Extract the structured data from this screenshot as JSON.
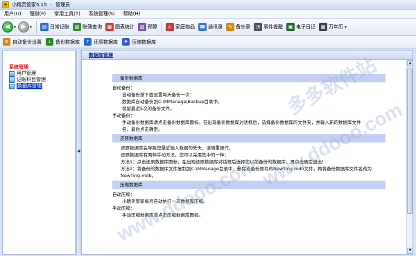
{
  "window": {
    "title": "小精灵管家5.15",
    "separator": "-",
    "user": "管理员"
  },
  "menu": [
    "用户(U)",
    "理财(F)",
    "常用工具(T)",
    "系统管理(S)",
    "帮助(H)"
  ],
  "toolbar": {
    "buttons": [
      {
        "label": "日常记账",
        "icon": "ledger-icon",
        "color": "#2f6fd0"
      },
      {
        "label": "账簿查询",
        "icon": "book-icon",
        "color": "#3a8a3a"
      },
      {
        "label": "图表统计",
        "icon": "chart-icon",
        "color": "#d04040"
      },
      {
        "label": "预算",
        "icon": "budget-icon",
        "color": "#7a5aa8"
      },
      {
        "label": "家庭物品",
        "icon": "home-items-icon",
        "color": "#c43a3a"
      },
      {
        "label": "通讯录",
        "icon": "contacts-icon",
        "color": "#3a7ac4"
      },
      {
        "label": "备忘录",
        "icon": "memo-icon",
        "color": "#d48a1a"
      },
      {
        "label": "事件提醒",
        "icon": "alarm-clock-icon",
        "color": "#555555"
      },
      {
        "label": "电子日记",
        "icon": "diary-icon",
        "color": "#2a6a2a"
      },
      {
        "label": "万年历",
        "icon": "calendar-icon",
        "color": "#444444"
      }
    ]
  },
  "toolbar2": {
    "buttons": [
      {
        "label": "自动备份设置",
        "icon": "backup-settings-icon",
        "color": "#c98a1a"
      },
      {
        "label": "备份数据库",
        "icon": "backup-db-icon",
        "color": "#2a8a2a"
      },
      {
        "label": "还原数据库",
        "icon": "restore-db-icon",
        "color": "#2a6ac4"
      },
      {
        "label": "压缩数据库",
        "icon": "compress-db-icon",
        "color": "#3a5ad4"
      }
    ]
  },
  "sidebar": {
    "root": "系统管理",
    "items": [
      {
        "label": "用户管理",
        "selected": false
      },
      {
        "label": "记账科目管理",
        "selected": false
      },
      {
        "label": "数据库管理",
        "selected": true
      }
    ]
  },
  "main": {
    "header": "数据库管理",
    "sections": [
      {
        "heading": "备份数据库",
        "lines": [
          {
            "indent": 0,
            "text": "自动备份："
          },
          {
            "indent": 1,
            "text": "自动备份按下面设置每天备份一次："
          },
          {
            "indent": 1,
            "text": "数据库自动备份到C:\\MManage\\Backup目录中。"
          },
          {
            "indent": 1,
            "text": "保留最近5次的备份文件。"
          },
          {
            "indent": 0,
            "text": "手动备份："
          },
          {
            "indent": 1,
            "text": "手动备份数据库请点击备份数据库图标，在出现备份数据库对话框后，选择备份数据库的文件夹，并输入新的数据库文件"
          },
          {
            "indent": 1,
            "text": "名，最后点击确定。"
          }
        ]
      },
      {
        "heading": "还原数据库",
        "lines": [
          {
            "indent": 2,
            "text": "还原数据库会导致您最近输入数据的丢失，请慎重操作。"
          },
          {
            "indent": 2,
            "text": "还原数据库有两种手动方法，您可以采用其中的一种："
          },
          {
            "indent": 2,
            "text": "方法1：点击还原数据库图标，在出现还原数据库对话框后选择您以前备份的数据库，再点击确定退出！"
          },
          {
            "indent": 2,
            "text": "方法2：将备份的数据库文件复制到C:\\MManage目录中，删除或备份原有的NewTing.mdb文件，再将备份数据库文件名改为"
          },
          {
            "indent": 2,
            "text": "NewTing.mdb。"
          }
        ]
      },
      {
        "heading": "压缩数据库",
        "lines": [
          {
            "indent": 0,
            "text": "自动压缩："
          },
          {
            "indent": 1,
            "text": "小精灵管家每月自动执行一次数据库压缩。"
          },
          {
            "indent": 0,
            "text": "手动压缩："
          },
          {
            "indent": 1,
            "text": "手动压缩数据库请点击压缩数据库图标。"
          }
        ]
      }
    ]
  },
  "watermarks": [
    "多多软件站",
    "www.ddooo.com"
  ]
}
